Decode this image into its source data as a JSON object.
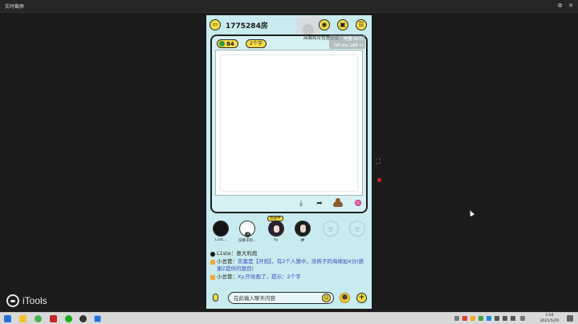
{
  "window": {
    "title": "实时截屏"
  },
  "brand": {
    "name": "iTools"
  },
  "room": {
    "title": "1775284房"
  },
  "overlay": {
    "notice": "商城和背包里还没…",
    "battery": "电量:60%",
    "speed": "58 ms   168 m"
  },
  "round": {
    "timer": "84",
    "hint": "2个字"
  },
  "toolbar": {
    "download": "⤓",
    "share": "➦"
  },
  "players": [
    {
      "name": "L1st...",
      "score": "",
      "drawing_tag": ""
    },
    {
      "name": "没裤子的...",
      "score": "3",
      "drawing_tag": ""
    },
    {
      "name": "Xy.",
      "score": "",
      "drawing_tag": "绘画中"
    },
    {
      "name": "押",
      "score": "",
      "drawing_tag": ""
    },
    {
      "name": "",
      "empty_label": "空"
    },
    {
      "name": "",
      "empty_label": "空"
    }
  ],
  "chat": {
    "messages": [
      {
        "sender": "L1ste：",
        "text": "意大利炮"
      },
      {
        "sender": "小总管：",
        "text": "答案是【开炮】，有2个人猜中，没裤子的海绵加4分(感谢Z提供的题目)"
      },
      {
        "sender": "小总管：",
        "text": "Xy.开始画了，提示：2个字"
      }
    ]
  },
  "input": {
    "placeholder": "在此输入聊天内容"
  },
  "taskbar": {
    "time": "2:04",
    "date": "2021/5/29"
  },
  "colors": {
    "phone_bg": "#c8ebef",
    "accent_yellow": "#f5dc45",
    "chat_blue": "#3c4fbf"
  }
}
